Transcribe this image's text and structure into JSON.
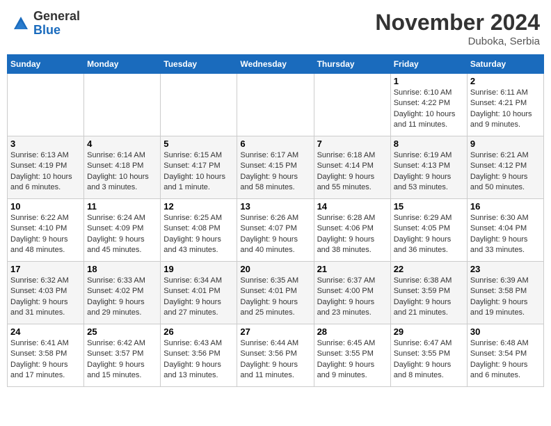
{
  "logo": {
    "general": "General",
    "blue": "Blue"
  },
  "title": "November 2024",
  "location": "Duboka, Serbia",
  "days_of_week": [
    "Sunday",
    "Monday",
    "Tuesday",
    "Wednesday",
    "Thursday",
    "Friday",
    "Saturday"
  ],
  "weeks": [
    [
      {
        "day": "",
        "info": ""
      },
      {
        "day": "",
        "info": ""
      },
      {
        "day": "",
        "info": ""
      },
      {
        "day": "",
        "info": ""
      },
      {
        "day": "",
        "info": ""
      },
      {
        "day": "1",
        "info": "Sunrise: 6:10 AM\nSunset: 4:22 PM\nDaylight: 10 hours\nand 11 minutes."
      },
      {
        "day": "2",
        "info": "Sunrise: 6:11 AM\nSunset: 4:21 PM\nDaylight: 10 hours\nand 9 minutes."
      }
    ],
    [
      {
        "day": "3",
        "info": "Sunrise: 6:13 AM\nSunset: 4:19 PM\nDaylight: 10 hours\nand 6 minutes."
      },
      {
        "day": "4",
        "info": "Sunrise: 6:14 AM\nSunset: 4:18 PM\nDaylight: 10 hours\nand 3 minutes."
      },
      {
        "day": "5",
        "info": "Sunrise: 6:15 AM\nSunset: 4:17 PM\nDaylight: 10 hours\nand 1 minute."
      },
      {
        "day": "6",
        "info": "Sunrise: 6:17 AM\nSunset: 4:15 PM\nDaylight: 9 hours\nand 58 minutes."
      },
      {
        "day": "7",
        "info": "Sunrise: 6:18 AM\nSunset: 4:14 PM\nDaylight: 9 hours\nand 55 minutes."
      },
      {
        "day": "8",
        "info": "Sunrise: 6:19 AM\nSunset: 4:13 PM\nDaylight: 9 hours\nand 53 minutes."
      },
      {
        "day": "9",
        "info": "Sunrise: 6:21 AM\nSunset: 4:12 PM\nDaylight: 9 hours\nand 50 minutes."
      }
    ],
    [
      {
        "day": "10",
        "info": "Sunrise: 6:22 AM\nSunset: 4:10 PM\nDaylight: 9 hours\nand 48 minutes."
      },
      {
        "day": "11",
        "info": "Sunrise: 6:24 AM\nSunset: 4:09 PM\nDaylight: 9 hours\nand 45 minutes."
      },
      {
        "day": "12",
        "info": "Sunrise: 6:25 AM\nSunset: 4:08 PM\nDaylight: 9 hours\nand 43 minutes."
      },
      {
        "day": "13",
        "info": "Sunrise: 6:26 AM\nSunset: 4:07 PM\nDaylight: 9 hours\nand 40 minutes."
      },
      {
        "day": "14",
        "info": "Sunrise: 6:28 AM\nSunset: 4:06 PM\nDaylight: 9 hours\nand 38 minutes."
      },
      {
        "day": "15",
        "info": "Sunrise: 6:29 AM\nSunset: 4:05 PM\nDaylight: 9 hours\nand 36 minutes."
      },
      {
        "day": "16",
        "info": "Sunrise: 6:30 AM\nSunset: 4:04 PM\nDaylight: 9 hours\nand 33 minutes."
      }
    ],
    [
      {
        "day": "17",
        "info": "Sunrise: 6:32 AM\nSunset: 4:03 PM\nDaylight: 9 hours\nand 31 minutes."
      },
      {
        "day": "18",
        "info": "Sunrise: 6:33 AM\nSunset: 4:02 PM\nDaylight: 9 hours\nand 29 minutes."
      },
      {
        "day": "19",
        "info": "Sunrise: 6:34 AM\nSunset: 4:01 PM\nDaylight: 9 hours\nand 27 minutes."
      },
      {
        "day": "20",
        "info": "Sunrise: 6:35 AM\nSunset: 4:01 PM\nDaylight: 9 hours\nand 25 minutes."
      },
      {
        "day": "21",
        "info": "Sunrise: 6:37 AM\nSunset: 4:00 PM\nDaylight: 9 hours\nand 23 minutes."
      },
      {
        "day": "22",
        "info": "Sunrise: 6:38 AM\nSunset: 3:59 PM\nDaylight: 9 hours\nand 21 minutes."
      },
      {
        "day": "23",
        "info": "Sunrise: 6:39 AM\nSunset: 3:58 PM\nDaylight: 9 hours\nand 19 minutes."
      }
    ],
    [
      {
        "day": "24",
        "info": "Sunrise: 6:41 AM\nSunset: 3:58 PM\nDaylight: 9 hours\nand 17 minutes."
      },
      {
        "day": "25",
        "info": "Sunrise: 6:42 AM\nSunset: 3:57 PM\nDaylight: 9 hours\nand 15 minutes."
      },
      {
        "day": "26",
        "info": "Sunrise: 6:43 AM\nSunset: 3:56 PM\nDaylight: 9 hours\nand 13 minutes."
      },
      {
        "day": "27",
        "info": "Sunrise: 6:44 AM\nSunset: 3:56 PM\nDaylight: 9 hours\nand 11 minutes."
      },
      {
        "day": "28",
        "info": "Sunrise: 6:45 AM\nSunset: 3:55 PM\nDaylight: 9 hours\nand 9 minutes."
      },
      {
        "day": "29",
        "info": "Sunrise: 6:47 AM\nSunset: 3:55 PM\nDaylight: 9 hours\nand 8 minutes."
      },
      {
        "day": "30",
        "info": "Sunrise: 6:48 AM\nSunset: 3:54 PM\nDaylight: 9 hours\nand 6 minutes."
      }
    ]
  ]
}
